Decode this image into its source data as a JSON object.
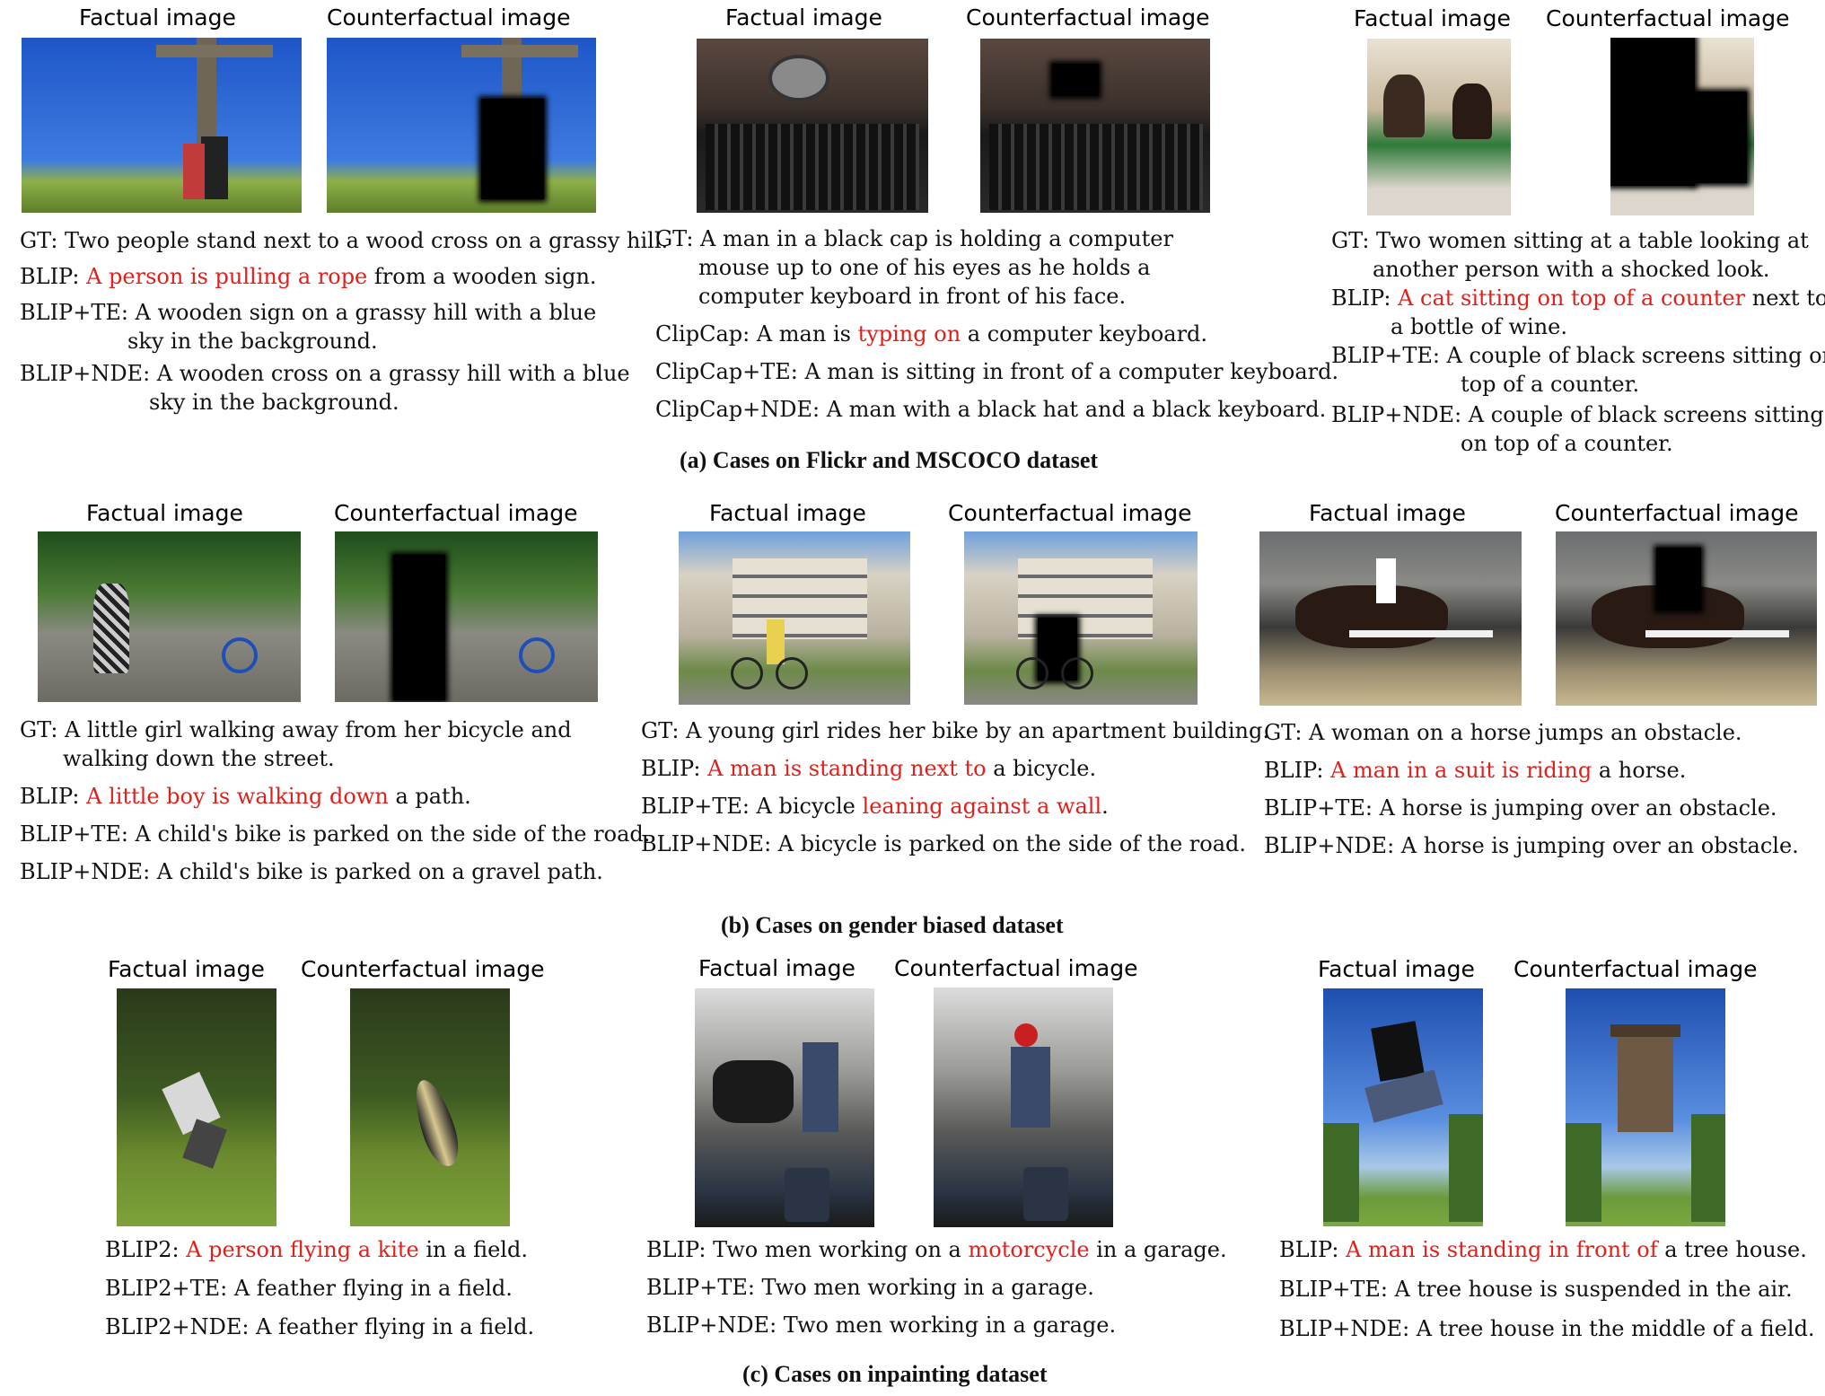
{
  "labels": {
    "factual": "Factual image",
    "counterfactual": "Counterfactual image"
  },
  "sections": {
    "a": "(a) Cases on Flickr and MSCOCO dataset",
    "b": "(b) Cases on gender biased dataset",
    "c": "(c) Cases on inpainting dataset"
  },
  "a1": {
    "gt": "GT: Two people stand next to a wood cross on a grassy hill.",
    "l2_pre": "BLIP: ",
    "l2_red": "A person is pulling a rope",
    "l2_post": " from a wooden sign.",
    "l3a": "BLIP+TE: A wooden sign on a grassy hill with a blue",
    "l3b": "sky in the background.",
    "l4a": "BLIP+NDE: A wooden cross on a grassy hill with a blue",
    "l4b": "sky in the background."
  },
  "a2": {
    "gt_a": "GT: A man in a black cap is holding a computer",
    "gt_b": "mouse up to one of his eyes as he holds a",
    "gt_c": "computer keyboard in front of his face.",
    "l2_pre": "ClipCap: A man is ",
    "l2_red": "typing on",
    "l2_post": " a computer keyboard.",
    "l3": "ClipCap+TE: A man is sitting in front of a computer keyboard.",
    "l4": "ClipCap+NDE: A man with a black hat and a black keyboard."
  },
  "a3": {
    "gt_a": "GT: Two women sitting at a table looking at",
    "gt_b": "another person with a shocked look.",
    "l2_pre": "BLIP: ",
    "l2_red": "A cat sitting on top of a counter",
    "l2_post": " next to",
    "l2b": "a bottle of wine.",
    "l3a": "BLIP+TE: A couple of black screens sitting on",
    "l3b": "top of a counter.",
    "l4a": "BLIP+NDE: A couple of black screens sitting",
    "l4b": "on top of a counter."
  },
  "b1": {
    "gt_a": "GT: A little girl walking away from her bicycle and",
    "gt_b": "walking down the street.",
    "l2_pre": "BLIP: ",
    "l2_red": "A little boy is walking down",
    "l2_post": " a path.",
    "l3": "BLIP+TE: A child's bike is parked on the side of the road.",
    "l4": "BLIP+NDE: A child's bike is parked on a gravel path."
  },
  "b2": {
    "gt": "GT: A young girl rides her bike by an apartment building.",
    "l2_pre": "BLIP: ",
    "l2_red": "A man is standing next to",
    "l2_post": " a bicycle.",
    "l3_pre": "BLIP+TE: A bicycle ",
    "l3_red": "leaning against a wall",
    "l3_post": ".",
    "l4": "BLIP+NDE: A bicycle is parked on the side of the road."
  },
  "b3": {
    "gt": "GT: A woman on a horse jumps an obstacle.",
    "l2_pre": "BLIP: ",
    "l2_red": "A man in a suit is riding",
    "l2_post": " a horse.",
    "l3": "BLIP+TE: A horse is jumping over an obstacle.",
    "l4": "BLIP+NDE: A horse is jumping over an obstacle."
  },
  "c1": {
    "l1_pre": "BLIP2: ",
    "l1_red": "A person flying a kite",
    "l1_post": " in a field.",
    "l2": "BLIP2+TE: A feather flying in a field.",
    "l3": "BLIP2+NDE: A feather flying in a field."
  },
  "c2": {
    "l1_pre": "BLIP: Two men working on a ",
    "l1_red": "motorcycle",
    "l1_post": " in a garage.",
    "l2": "BLIP+TE: Two men working in a garage.",
    "l3": "BLIP+NDE: Two men working in a garage."
  },
  "c3": {
    "l1_pre": "BLIP: ",
    "l1_red": "A man is standing in front of",
    "l1_post": " a tree house.",
    "l2": "BLIP+TE: A tree house is suspended in the air.",
    "l3": "BLIP+NDE: A tree house in the middle of a field."
  }
}
